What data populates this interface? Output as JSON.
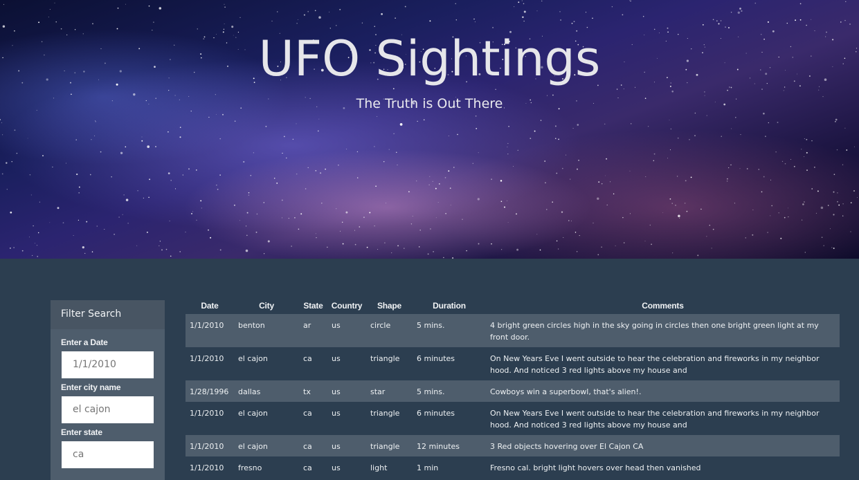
{
  "hero": {
    "title": "UFO Sightings",
    "subtitle": "The Truth is Out There"
  },
  "filter": {
    "header": "Filter Search",
    "date_label": "Enter a Date",
    "date_placeholder": "1/1/2010",
    "city_label": "Enter city name",
    "city_placeholder": "el cajon",
    "state_label": "Enter state",
    "state_placeholder": "ca"
  },
  "table": {
    "columns": [
      "Date",
      "City",
      "State",
      "Country",
      "Shape",
      "Duration",
      "Comments"
    ],
    "rows": [
      {
        "date": "1/1/2010",
        "city": "benton",
        "state": "ar",
        "country": "us",
        "shape": "circle",
        "duration": "5 mins.",
        "comments": "4 bright green circles high in the sky going in circles then one bright green light at my front door."
      },
      {
        "date": "1/1/2010",
        "city": "el cajon",
        "state": "ca",
        "country": "us",
        "shape": "triangle",
        "duration": "6 minutes",
        "comments": "On New Years Eve I went outside to hear the celebration and fireworks in my neighbor hood. And noticed 3 red lights above my house and"
      },
      {
        "date": "1/28/1996",
        "city": "dallas",
        "state": "tx",
        "country": "us",
        "shape": "star",
        "duration": "5 mins.",
        "comments": "Cowboys win a superbowl, that's alien!."
      },
      {
        "date": "1/1/2010",
        "city": "el cajon",
        "state": "ca",
        "country": "us",
        "shape": "triangle",
        "duration": "6 minutes",
        "comments": "On New Years Eve I went outside to hear the celebration and fireworks in my neighbor hood. And noticed 3 red lights above my house and"
      },
      {
        "date": "1/1/2010",
        "city": "el cajon",
        "state": "ca",
        "country": "us",
        "shape": "triangle",
        "duration": "12 minutes",
        "comments": "3 Red objects hovering over El Cajon CA"
      },
      {
        "date": "1/1/2010",
        "city": "fresno",
        "state": "ca",
        "country": "us",
        "shape": "light",
        "duration": "1 min",
        "comments": "Fresno cal. bright light hovers over head then vanished"
      }
    ]
  }
}
